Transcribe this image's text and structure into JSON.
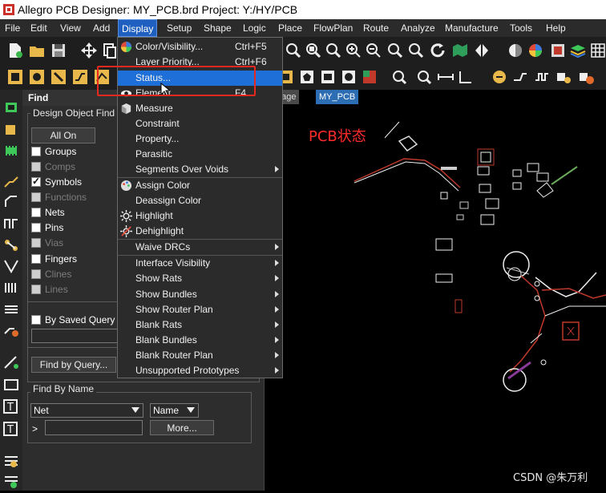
{
  "window": {
    "title": "Allegro PCB Designer: MY_PCB.brd  Project: Y:/HY/PCB"
  },
  "menubar": [
    "File",
    "Edit",
    "View",
    "Add",
    "Display",
    "Setup",
    "Shape",
    "Logic",
    "Place",
    "FlowPlan",
    "Route",
    "Analyze",
    "Manufacture",
    "Tools",
    "Help"
  ],
  "find_panel": {
    "title": "Find",
    "group_title": "Design Object Find F",
    "all_on": "All On",
    "checkboxes": [
      {
        "label": "Groups",
        "checked": false,
        "enabled": true
      },
      {
        "label": "Comps",
        "checked": false,
        "enabled": false
      },
      {
        "label": "Symbols",
        "checked": true,
        "enabled": true
      },
      {
        "label": "Functions",
        "checked": false,
        "enabled": false
      },
      {
        "label": "Nets",
        "checked": false,
        "enabled": true
      },
      {
        "label": "Pins",
        "checked": false,
        "enabled": true
      },
      {
        "label": "Vias",
        "checked": false,
        "enabled": false
      },
      {
        "label": "Fingers",
        "checked": false,
        "enabled": true
      },
      {
        "label": "Clines",
        "checked": false,
        "enabled": false
      },
      {
        "label": "Lines",
        "checked": false,
        "enabled": false
      }
    ],
    "by_saved_query": "By Saved Query",
    "find_by_query": "Find by Query...",
    "find_by_name": "Find By Name",
    "name_type": "Net",
    "name_mode": "Name",
    "prompt": ">",
    "more": "More..."
  },
  "tabs": {
    "start_page": "rt Page",
    "design": "MY_PCB"
  },
  "display_menu": {
    "items": [
      {
        "label": "Color/Visibility...",
        "shortcut": "Ctrl+F5",
        "icon": "color-wheel-icon"
      },
      {
        "label": "Layer Priority...",
        "shortcut": "Ctrl+F6"
      },
      {
        "label": "Status...",
        "highlighted": true
      },
      {
        "label": "Element",
        "shortcut": "F4",
        "icon": "eye-icon"
      },
      {
        "label": "Measure",
        "icon": "cube-icon"
      },
      {
        "label": "Constraint"
      },
      {
        "label": "Property..."
      },
      {
        "label": "Parasitic"
      },
      {
        "label": "Segments Over Voids",
        "submenu": true
      },
      {
        "label": "Assign Color",
        "icon": "palette-icon"
      },
      {
        "label": "Deassign Color"
      },
      {
        "label": "Highlight",
        "icon": "highlight-sun-icon"
      },
      {
        "label": "Dehighlight",
        "icon": "dehighlight-sun-icon"
      },
      {
        "label": "Waive DRCs",
        "submenu": true
      },
      {
        "label": "Interface Visibility",
        "submenu": true
      },
      {
        "label": "Show Rats",
        "submenu": true
      },
      {
        "label": "Show Bundles",
        "submenu": true
      },
      {
        "label": "Show Router Plan",
        "submenu": true
      },
      {
        "label": "Blank Rats",
        "submenu": true
      },
      {
        "label": "Blank Bundles",
        "submenu": true
      },
      {
        "label": "Blank Router Plan",
        "submenu": true
      },
      {
        "label": "Unsupported Prototypes",
        "submenu": true
      }
    ]
  },
  "annotation": {
    "text": "PCB状态",
    "color": "#ff2b2b"
  },
  "watermark": "CSDN @朱万利",
  "colors": {
    "highlight": "#1f6fd8",
    "menu_bg": "#2b2b2b",
    "callout": "#e8271e"
  }
}
